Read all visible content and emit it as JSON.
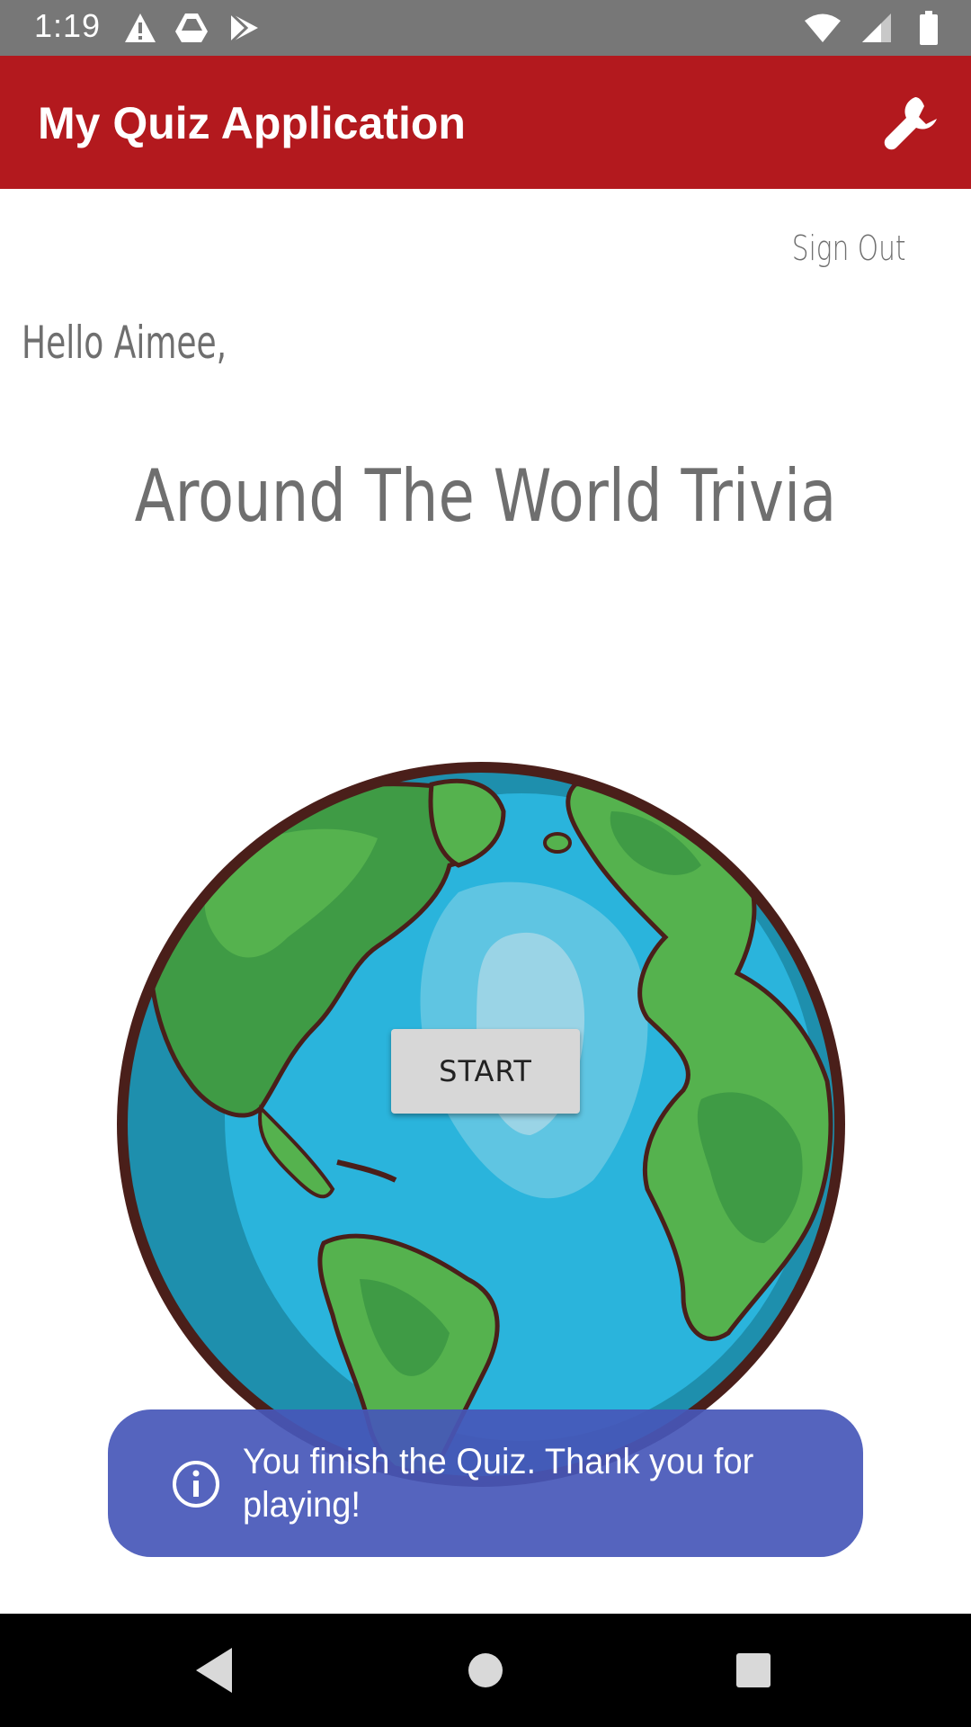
{
  "status_bar": {
    "time": "1:19",
    "left_icons": [
      "warning-icon",
      "drive-icon",
      "play-store-icon"
    ],
    "right_icons": [
      "wifi-icon",
      "cell-signal-icon",
      "battery-icon"
    ]
  },
  "app_bar": {
    "title": "My Quiz Application",
    "action_icon": "wrench-icon",
    "color": "#B3191E"
  },
  "content": {
    "sign_out_label": "Sign Out",
    "greeting": "Hello Aimee,",
    "quiz_title": "Around The World Trivia",
    "start_label": "START"
  },
  "toast": {
    "icon": "info-icon",
    "message": "You finish the Quiz. Thank you for playing!",
    "color": "#4657B9"
  },
  "nav_bar": {
    "buttons": [
      "back-icon",
      "home-icon",
      "recents-icon"
    ]
  }
}
